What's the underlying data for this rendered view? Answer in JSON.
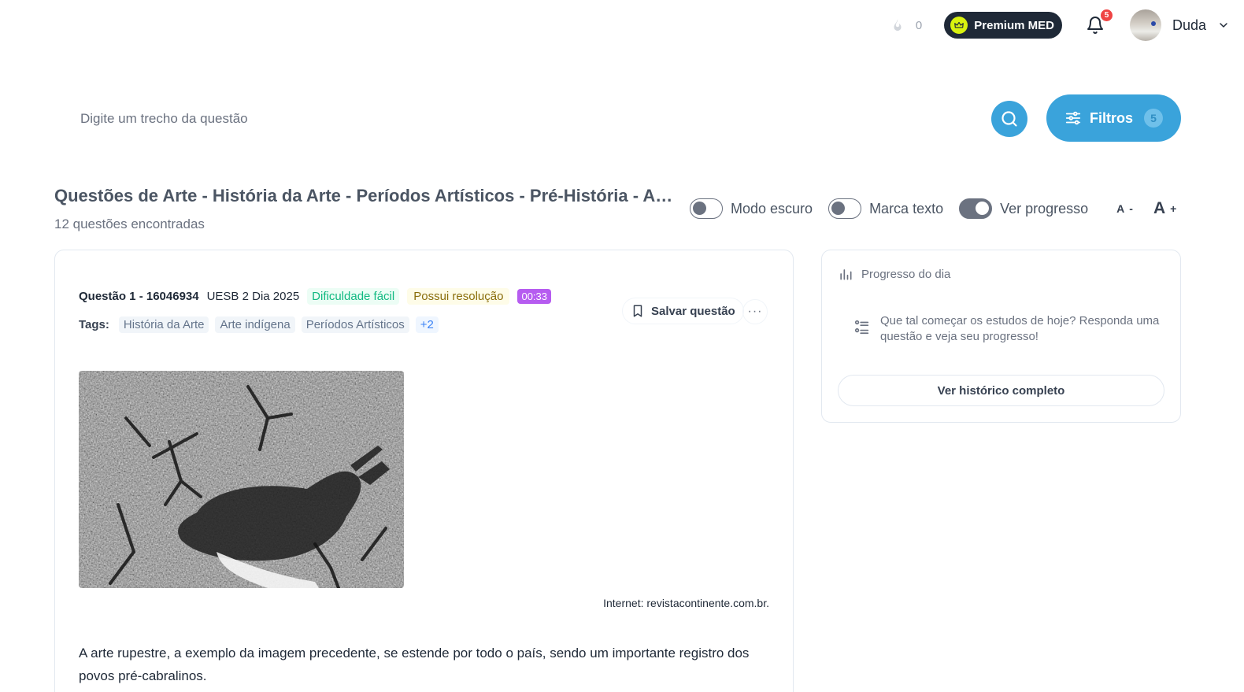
{
  "topbar": {
    "streak_count": "0",
    "premium_label": "Premium MED",
    "notification_count": "5",
    "username": "Duda"
  },
  "search": {
    "placeholder": "Digite um trecho da questão",
    "filters_label": "Filtros",
    "filters_count": "5"
  },
  "header": {
    "title": "Questões de Arte - História da Arte - Períodos Artísticos - Pré-História - Arte Rupestre",
    "subtitle": "12 questões encontradas",
    "toggles": [
      {
        "label": "Modo escuro",
        "on": false
      },
      {
        "label": "Marca texto",
        "on": false
      },
      {
        "label": "Ver progresso",
        "on": true
      }
    ],
    "font_decrease_label": "A",
    "font_decrease_sign": "-",
    "font_increase_label": "A",
    "font_increase_sign": "+"
  },
  "question": {
    "id_label": "Questão 1 - 16046934",
    "institution": "UESB 2 Dia 2025",
    "difficulty": "Dificuldade fácil",
    "resolution": "Possui resolução",
    "timer": "00:33",
    "tags_label": "Tags:",
    "tags": [
      "História da Arte",
      "Arte indígena",
      "Períodos Artísticos"
    ],
    "tags_more": "+2",
    "save_label": "Salvar questão",
    "more_label": "···",
    "image_caption": "Internet: revistacontinente.com.br.",
    "body": "A arte rupestre, a exemplo da imagem precedente, se estende por todo o país, sendo um importante registro dos povos pré-cabralinos."
  },
  "progress": {
    "title": "Progresso do dia",
    "message": "Que tal começar os estudos de hoje? Responda uma questão e veja seu progresso!",
    "history_button": "Ver histórico completo"
  },
  "colors": {
    "accent": "#3aa3db",
    "premium_bg": "#1f2937",
    "crown": "#d9f20f",
    "badge": "#ef4444",
    "timer": "#b65cf0"
  }
}
